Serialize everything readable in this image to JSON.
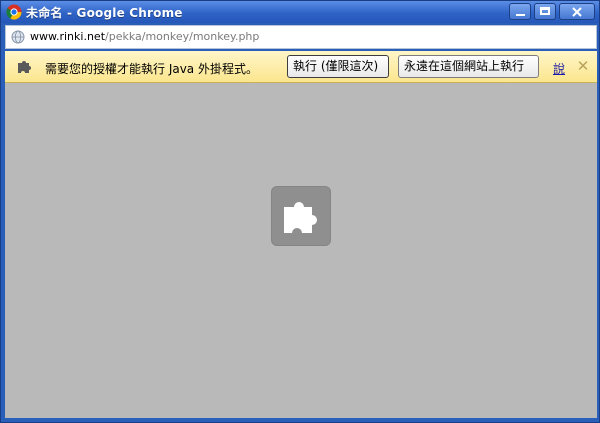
{
  "window": {
    "title": "未命名 - Google Chrome"
  },
  "address_bar": {
    "host": "www.rinki.net",
    "path": "/pekka/monkey/monkey.php"
  },
  "infobar": {
    "message": "需要您的授權才能執行 Java 外掛程式。",
    "run_once_label": "執行 (僅限這次)",
    "run_always_label": "永遠在這個網站上執行",
    "link_label": "說"
  },
  "colors": {
    "titlebar": "#2f63c6",
    "infobar": "#fbe68d",
    "content_bg": "#b9b9b9",
    "link": "#1a1aa6"
  },
  "icons": {
    "app": "chrome-icon",
    "site": "globe-icon",
    "infobar": "puzzle-piece-icon",
    "content": "plugin-placeholder-icon",
    "close": "close-icon"
  }
}
